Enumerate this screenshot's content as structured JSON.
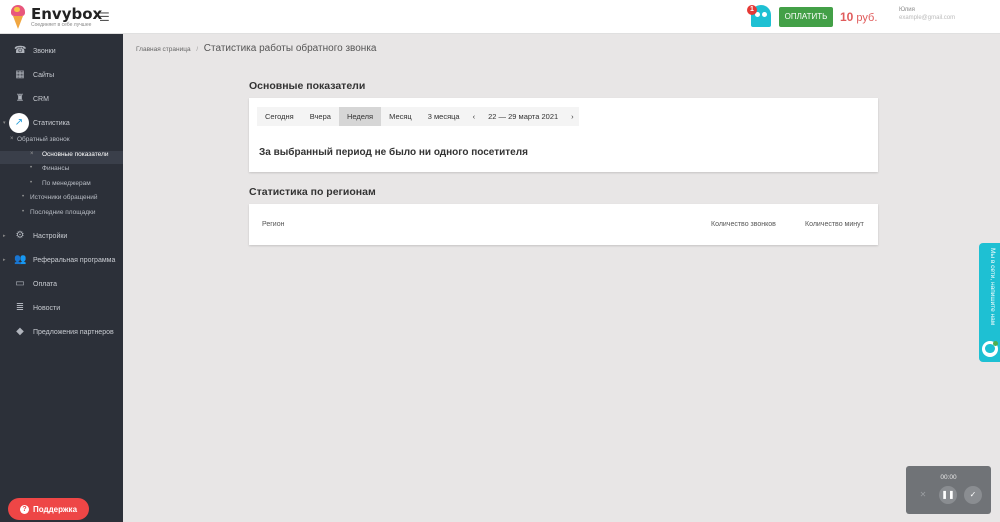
{
  "header": {
    "logo_name": "Envybox",
    "logo_tagline": "Соединяет в себе лучшее",
    "menu_icon": "hamburger-icon",
    "notification_count": "1",
    "pay_button": "ОПЛАТИТЬ",
    "balance_amount": "10",
    "balance_currency": "руб.",
    "user_name": "Юлия",
    "user_email": "example@gmail.com"
  },
  "sidebar": {
    "items": [
      {
        "label": "Звонки",
        "icon": "phone-icon"
      },
      {
        "label": "Сайты",
        "icon": "grid-icon"
      },
      {
        "label": "CRM",
        "icon": "crm-icon"
      },
      {
        "label": "Статистика",
        "icon": "trending-icon"
      },
      {
        "label": "Настройки",
        "icon": "gear-icon"
      },
      {
        "label": "Реферальная программа",
        "icon": "people-icon"
      },
      {
        "label": "Оплата",
        "icon": "card-icon"
      },
      {
        "label": "Новости",
        "icon": "news-icon"
      },
      {
        "label": "Предложения партнеров",
        "icon": "tag-icon"
      }
    ],
    "stats_sub": [
      {
        "label": "Обратный звонок"
      },
      {
        "label": "Основные показатели"
      },
      {
        "label": "Финансы"
      },
      {
        "label": "По менеджерам"
      },
      {
        "label": "Источники обращений"
      },
      {
        "label": "Последние площадки"
      }
    ],
    "support_button": "Поддержка"
  },
  "breadcrumb": {
    "home": "Главная страница",
    "separator": "/",
    "current": "Статистика работы обратного звонка"
  },
  "main_stats": {
    "title": "Основные показатели",
    "tabs": [
      "Сегодня",
      "Вчера",
      "Неделя",
      "Месяц",
      "3 месяца"
    ],
    "active_tab": "Неделя",
    "date_prev": "‹",
    "date_range": "22 — 29 марта 2021",
    "date_next": "›",
    "empty_message": "За выбранный период не было ни одного посетителя"
  },
  "regions": {
    "title": "Статистика по регионам",
    "columns": [
      "Регион",
      "Количество звонков",
      "Количество минут"
    ]
  },
  "side_widget": {
    "text": "Мы в сети, напишите нам"
  },
  "recorder": {
    "time": "00:00",
    "close_icon": "close-icon",
    "pause_icon": "pause-icon",
    "check_icon": "check-icon"
  }
}
